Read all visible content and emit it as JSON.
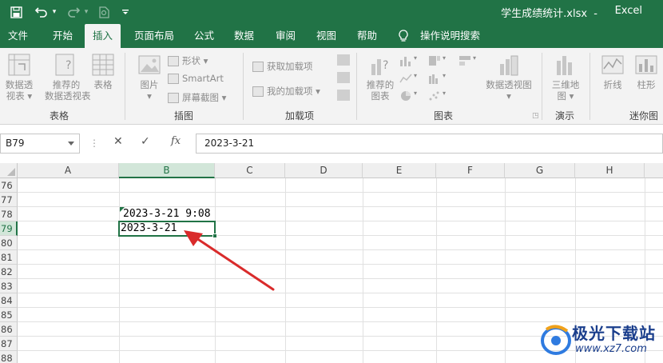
{
  "titlebar": {
    "file_name": "学生成绩统计.xlsx",
    "separator": "-",
    "app_name": "Excel"
  },
  "tabs": [
    "文件",
    "开始",
    "插入",
    "页面布局",
    "公式",
    "数据",
    "审阅",
    "视图",
    "帮助"
  ],
  "active_tab": "插入",
  "tell_me": "操作说明搜索",
  "ribbon": {
    "pivot_table": [
      "数据透",
      "视表"
    ],
    "recommended_pivot": [
      "推荐的",
      "数据透视表"
    ],
    "table": "表格",
    "pictures": "图片",
    "shapes": "形状",
    "smartart": "SmartArt",
    "screenshot": "屏幕截图",
    "get_addins": "获取加载项",
    "my_addins": "我的加载项",
    "recommended_charts": [
      "推荐的",
      "图表"
    ],
    "pivot_chart": "数据透视图",
    "map_3d": [
      "三维地",
      "图"
    ],
    "line": "折线",
    "column": "柱形",
    "groups": {
      "tables": "表格",
      "illustrations": "插图",
      "addins": "加载项",
      "charts": "图表",
      "tours": "演示",
      "sparklines": "迷你图"
    }
  },
  "formula_bar": {
    "name_box": "B79",
    "fx": "fx",
    "content": "2023-3-21"
  },
  "grid": {
    "columns": [
      "A",
      "B",
      "C",
      "D",
      "E",
      "F",
      "G",
      "H"
    ],
    "selected_column": "B",
    "rows": [
      "76",
      "77",
      "78",
      "79",
      "80",
      "81",
      "82",
      "83",
      "84",
      "85",
      "86",
      "87",
      "88"
    ],
    "selected_row": "79",
    "cells": {
      "B78": "2023-3-21 9:08",
      "B79": "2023-3-21"
    }
  },
  "watermark": {
    "name": "极光下载站",
    "url": "www.xz7.com"
  },
  "colors": {
    "accent": "#217346",
    "arrow": "#d92b2b"
  }
}
